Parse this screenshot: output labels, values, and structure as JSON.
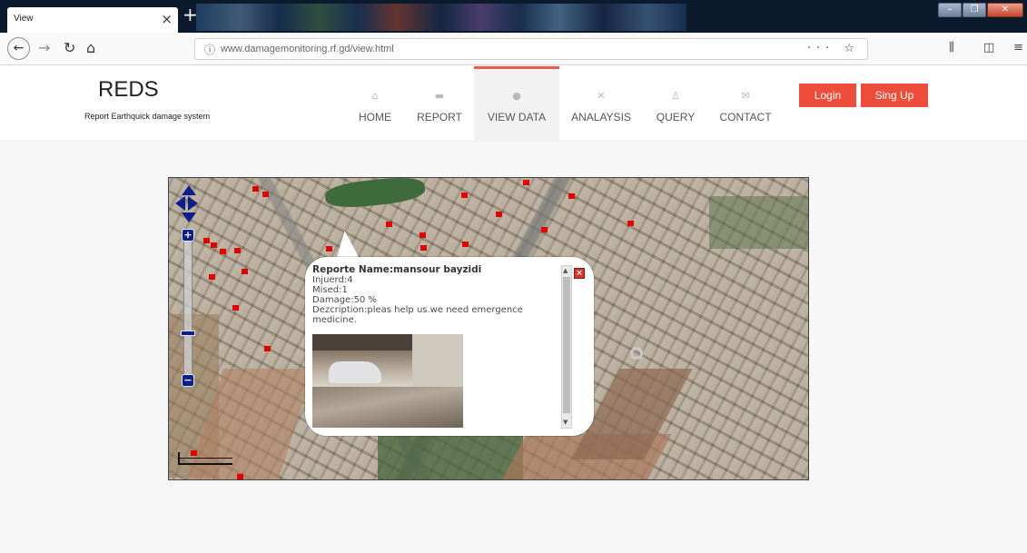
{
  "browser": {
    "tab_title": "View",
    "tab_close_glyph": "×",
    "new_tab_glyph": "+",
    "url_info_glyph": "ⓘ",
    "url": "www.damagemonitoring.rf.gd/view.html",
    "url_actions": "··· ☆",
    "icons": [
      "back-icon",
      "forward-icon",
      "reload-icon",
      "home-icon",
      "library-icon",
      "sidebar-icon",
      "menu-icon"
    ]
  },
  "site": {
    "brand": "REDS",
    "tagline": "Report Earthquick damage system",
    "menu": [
      {
        "label": "HOME",
        "icon": "⌂"
      },
      {
        "label": "REPORT",
        "icon": "▬"
      },
      {
        "label": "VIEW DATA",
        "icon": "●"
      },
      {
        "label": "ANALAYSIS",
        "icon": "✕"
      },
      {
        "label": "QUERY",
        "icon": "♙"
      },
      {
        "label": "CONTACT",
        "icon": "✉"
      }
    ],
    "active_menu": "VIEW DATA",
    "login_label": "Login",
    "signup_label": "Sing Up",
    "accent_color": "#ee4d3c"
  },
  "popup": {
    "name_line": "Reporte Name:mansour bayzidi",
    "injured_line": "Injuerd:4",
    "missed_line": "Mised:1",
    "damage_line": "Damage:50 %",
    "description_line": "Dezcription:pleas help us.we need emergence medicine.",
    "close_glyph": "×",
    "photo_icon": "damaged-building-photo"
  }
}
